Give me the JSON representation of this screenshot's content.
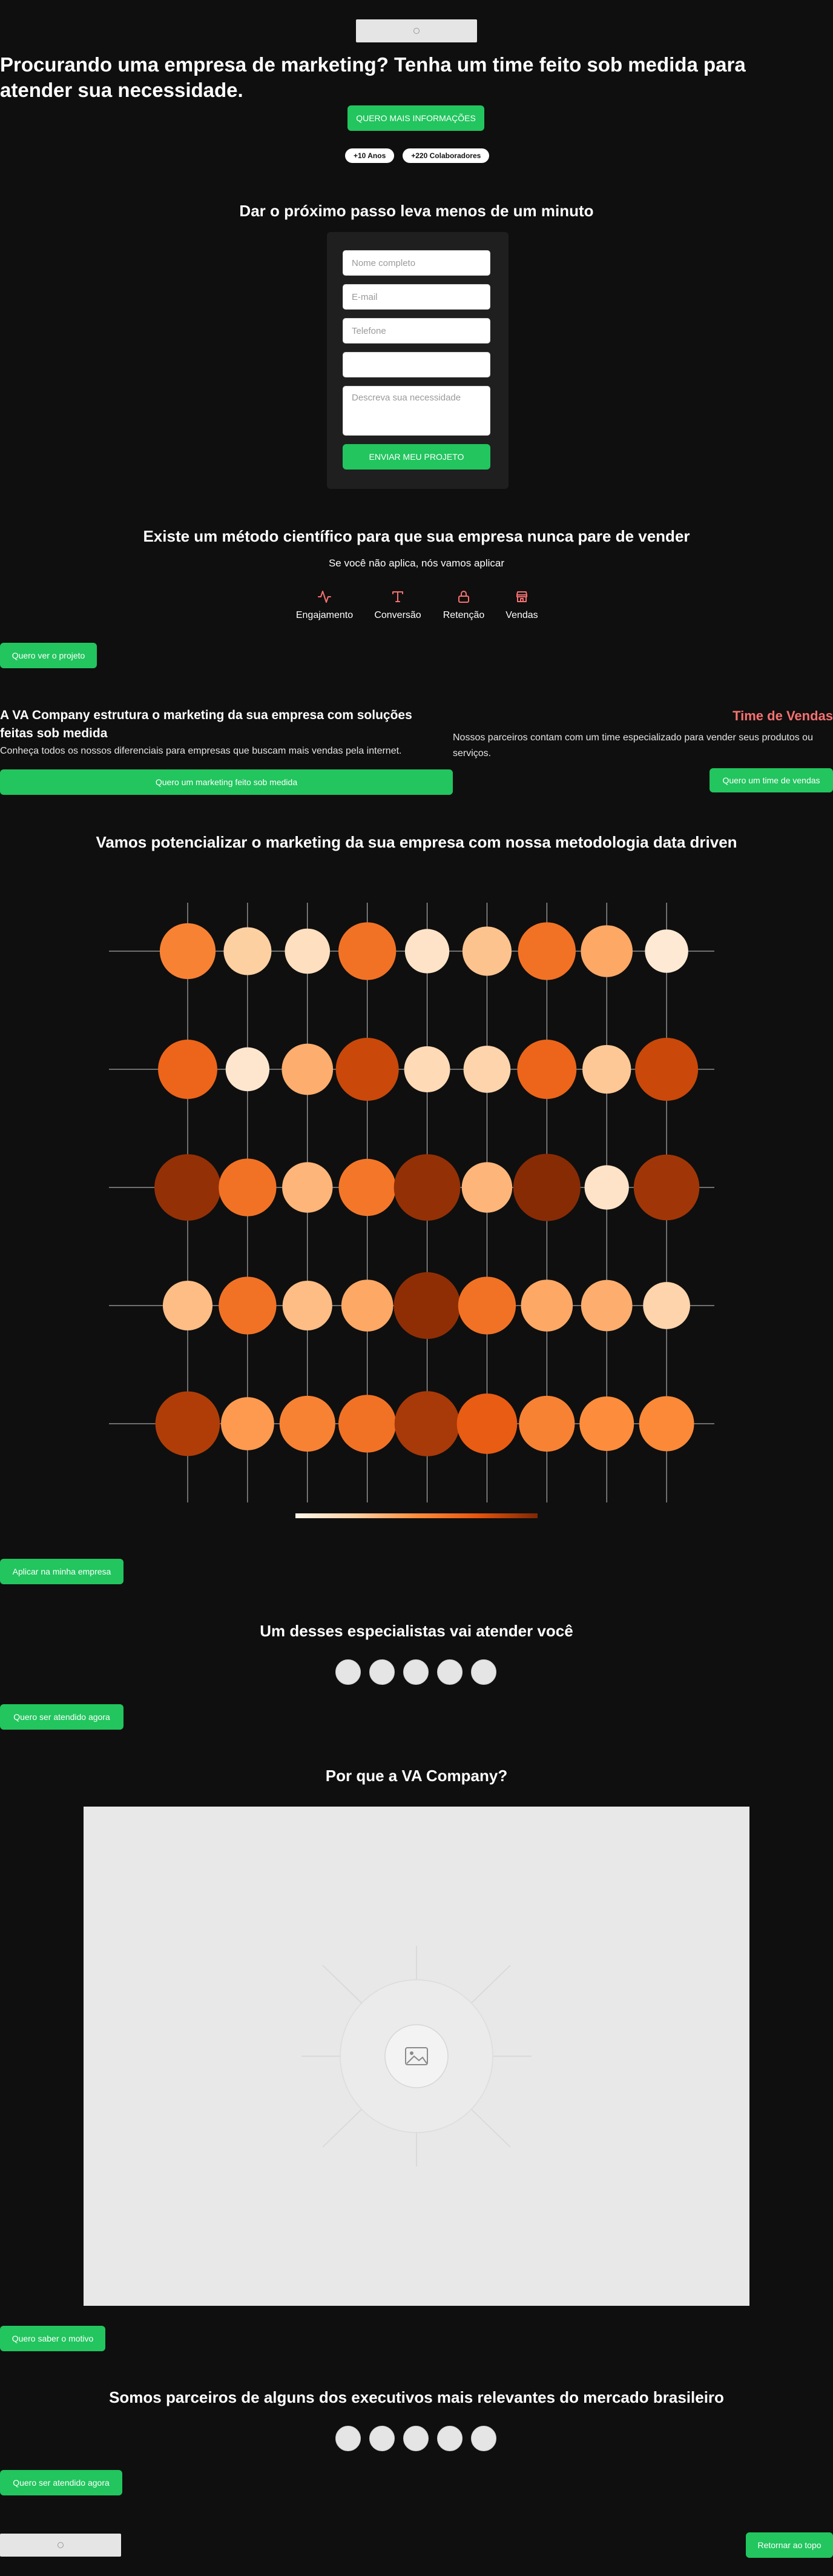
{
  "hero": {
    "title": "Procurando uma empresa de marketing? Tenha um time feito sob medida para atender sua necessidade.",
    "cta": "QUERO MAIS INFORMAÇÕES",
    "badges": [
      "+10 Anos",
      "+220 Colaboradores"
    ]
  },
  "form": {
    "title": "Dar o próximo passo leva menos de um minuto",
    "name_placeholder": "Nome completo",
    "email_placeholder": "E-mail",
    "phone_placeholder": "Telefone",
    "extra_value": "",
    "message_placeholder": "Descreva sua necessidade",
    "submit": "ENVIAR MEU PROJETO"
  },
  "method": {
    "title": "Existe um método científico para que sua empresa nunca pare de vender",
    "subtitle": "Se você não aplica, nós vamos aplicar",
    "items": [
      {
        "label": "Engajamento",
        "icon": "activity-icon"
      },
      {
        "label": "Conversão",
        "icon": "type-icon"
      },
      {
        "label": "Retenção",
        "icon": "lock-icon"
      },
      {
        "label": "Vendas",
        "icon": "store-icon"
      }
    ],
    "cta": "Quero ver o projeto"
  },
  "company": {
    "title": "A VA Company estrutura o marketing da sua empresa com soluções feitas sob medida",
    "text": "Conheça todos os nossos diferenciais para empresas que buscam mais vendas pela internet.",
    "cta": "Quero um marketing feito sob medida"
  },
  "sales_team": {
    "title": "Time de Vendas",
    "text": "Nossos parceiros contam com um time especializado para vender seus produtos ou serviços.",
    "cta": "Quero um time de vendas",
    "title_color": "#f87171"
  },
  "data_driven": {
    "title": "Vamos potencializar o marketing da sua empresa com nossa metodologia data driven",
    "cta": "Aplicar na minha empresa"
  },
  "chart_data": {
    "type": "heatmap",
    "rows": 5,
    "cols": 9,
    "values": [
      [
        0.55,
        0.25,
        0.15,
        0.62,
        0.12,
        0.3,
        0.62,
        0.4,
        0.08
      ],
      [
        0.68,
        0.1,
        0.38,
        0.82,
        0.18,
        0.22,
        0.68,
        0.28,
        0.82
      ],
      [
        0.95,
        0.62,
        0.35,
        0.6,
        0.95,
        0.35,
        0.98,
        0.12,
        0.92
      ],
      [
        0.32,
        0.62,
        0.32,
        0.4,
        0.96,
        0.62,
        0.4,
        0.38,
        0.22
      ],
      [
        0.88,
        0.45,
        0.55,
        0.62,
        0.9,
        0.72,
        0.55,
        0.5,
        0.52
      ]
    ],
    "legend_gradient": [
      "#fff5eb",
      "#fdd0a2",
      "#fd8d3c",
      "#e6550d",
      "#7f2704"
    ]
  },
  "specialists": {
    "title": "Um desses especialistas vai atender você",
    "cta": "Quero ser atendido agora"
  },
  "why": {
    "title": "Por que a VA Company?",
    "cta": "Quero saber o motivo"
  },
  "partners": {
    "title": "Somos parceiros de alguns dos executivos mais relevantes do mercado brasileiro",
    "cta": "Quero ser atendido agora"
  },
  "footer": {
    "back_to_top": "Retornar ao topo"
  }
}
